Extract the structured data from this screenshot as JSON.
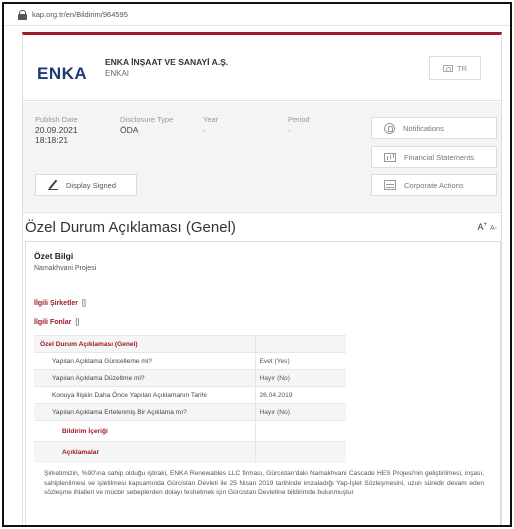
{
  "browser": {
    "url": "kap.org.tr/en/Bildirim/964595"
  },
  "company": {
    "logo_text": "ENKA",
    "name": "ENKA İNŞAAT VE SANAYİ A.Ş.",
    "code": "ENKAI",
    "language": "TR"
  },
  "meta": {
    "publish_date_label": "Publish Date",
    "publish_date": "20.09.2021",
    "publish_time": "18:18:21",
    "disclosure_type_label": "Disclosure Type",
    "disclosure_type": "ÖDA",
    "year_label": "Year",
    "year": "-",
    "period_label": "Period",
    "period": "-"
  },
  "actions": {
    "notifications": "Notifications",
    "financial_statements": "Financial Statements",
    "corporate_actions": "Corporate Actions",
    "display_signed": "Display Signed"
  },
  "disclosure": {
    "title": "Özel Durum Açıklaması (Genel)",
    "font_control_large": "A",
    "font_control_plus": "+",
    "font_control_small": "A-",
    "summary_label": "Özet Bilgi",
    "summary": "Namakhvani Projesi",
    "related_companies_label": "İlgili Şirketler",
    "related_companies_value": "[]",
    "related_funds_label": "İlgili Fonlar",
    "related_funds_value": "[]",
    "table_header": "Özel Durum Açıklaması (Genel)",
    "rows": [
      {
        "q": "Yapılan Açıklama Güncelleme mi?",
        "a": "Evet (Yes)"
      },
      {
        "q": "Yapılan Açıklama Düzeltme mi?",
        "a": "Hayır (No)"
      },
      {
        "q": "Konuya İlişkin Daha Önce Yapılan Açıklamanın Tarihi",
        "a": "26.04.2019"
      },
      {
        "q": "Yapılan Açıklama Ertelenmiş Bir Açıklama mı?",
        "a": "Hayır (No)"
      }
    ],
    "content_label": "Bildirim İçeriği",
    "explanations_label": "Açıklamalar",
    "body": "Şirketimizin, %90'ına sahip olduğu iştiraki, ENKA Renewables LLC firması, Gürcistan'daki Namakhvani Cascade HES Projesi'nin geliştirilmesi, inşası, sahiplenilmesi ve işletilmesi kapsamında Gürcistan Devleti ile 25 Nisan 2019 tarihinde imzaladığı Yap-İşlet Sözleşmesini, uzun süredir devam eden sözleşme ihlalleri ve mücbir sebeplerden dolayı feshetmek için Gürcistan Devletine bildirimde bulunmuştur"
  }
}
